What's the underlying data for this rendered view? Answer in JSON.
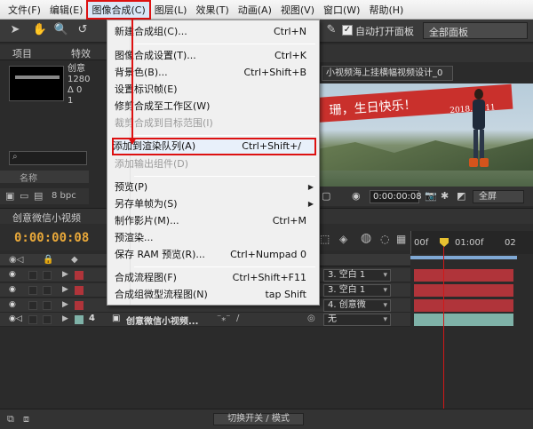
{
  "menubar": {
    "items": [
      "文件(F)",
      "编辑(E)",
      "图像合成(C)",
      "图层(L)",
      "效果(T)",
      "动画(A)",
      "视图(V)",
      "窗口(W)",
      "帮助(H)"
    ]
  },
  "toolbar": {
    "auto_open_label": "自动打开面板",
    "workspace": "全部面板"
  },
  "project_panel": {
    "tab_project": "项目",
    "tab_effects": "特效",
    "info_line1": "创意",
    "info_line2": "1280",
    "info_line3": "Δ 0",
    "info_line4": "1",
    "list_header": "名称",
    "bpc": "8 bpc"
  },
  "viewer": {
    "comp_name": "小视频海上挂横幅视频设计_0",
    "banner_text": "珊，生日快乐！",
    "banner_date": "2018.06.11",
    "timecode": "0:00:00:08",
    "resolution": "全屏"
  },
  "timeline": {
    "tab_label": "创意微信小视频",
    "current_time": "0:00:00:08",
    "ruler_0": "00f",
    "ruler_1": "01:00f",
    "ruler_2": "02",
    "col_name": "",
    "footer_toggle": "切换开关 / 模式",
    "layers": [
      {
        "num": "",
        "name": "",
        "parent": "3. 空白 1",
        "color": "#b0343a"
      },
      {
        "num": "",
        "name": "",
        "parent": "3. 空白 1",
        "color": "#b0343a"
      },
      {
        "num": "",
        "name": "",
        "parent": "4. 创意微",
        "color": "#b0343a"
      },
      {
        "num": "4",
        "name": "创意微信小视频...",
        "parent": "无",
        "color": "#7fb2a8"
      }
    ]
  },
  "menu": {
    "items": [
      {
        "label": "新建合成组(C)...",
        "shortcut": "Ctrl+N"
      },
      {
        "label": "图像合成设置(T)...",
        "shortcut": "Ctrl+K"
      },
      {
        "label": "背景色(B)...",
        "shortcut": "Ctrl+Shift+B"
      },
      {
        "label": "设置标识帧(E)",
        "shortcut": ""
      },
      {
        "label": "修剪合成至工作区(W)",
        "shortcut": ""
      },
      {
        "label": "裁剪合成到目标范围(I)",
        "shortcut": ""
      },
      {
        "label": "添加到渲染队列(A)",
        "shortcut": "Ctrl+Shift+/"
      },
      {
        "label": "添加输出组件(D)",
        "shortcut": ""
      },
      {
        "label": "预览(P)",
        "shortcut": ""
      },
      {
        "label": "另存单帧为(S)",
        "shortcut": ""
      },
      {
        "label": "制作影片(M)...",
        "shortcut": "Ctrl+M"
      },
      {
        "label": "预渲染...",
        "shortcut": ""
      },
      {
        "label": "保存 RAM 预览(R)...",
        "shortcut": "Ctrl+Numpad 0"
      },
      {
        "label": "合成流程图(F)",
        "shortcut": "Ctrl+Shift+F11"
      },
      {
        "label": "合成组微型流程图(N)",
        "shortcut": "tap Shift"
      }
    ]
  }
}
